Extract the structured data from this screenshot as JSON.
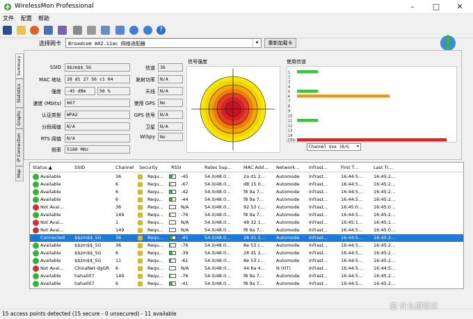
{
  "window": {
    "title": "WirelessMon Professional"
  },
  "menu": [
    "文件",
    "配置",
    "帮助"
  ],
  "adapter": {
    "label": "选择网卡",
    "value": "Broadcom 802.11ac 网络适配器",
    "reload": "重新加载卡"
  },
  "tabs": [
    "Summary",
    "Statistics",
    "Graphs",
    "IP Connection",
    "Map"
  ],
  "summary_left": [
    {
      "label": "SSID",
      "value": "$$zm$$_5G"
    },
    {
      "label": "MAC 地址",
      "value": "28 d1 27 56 c1 04"
    },
    {
      "label": "强度",
      "value": "-45 dBm",
      "value2": "56 %"
    },
    {
      "label": "速度 (Mbits)",
      "value": "667"
    },
    {
      "label": "认证类型",
      "value": "WPA2"
    },
    {
      "label": "分段阈值",
      "value": "N/A"
    },
    {
      "label": "RTS 阈值",
      "value": "N/A"
    },
    {
      "label": "频率",
      "value": "5180 MHz"
    }
  ],
  "summary_right": [
    {
      "label": "信道",
      "value": "36"
    },
    {
      "label": "发射功率",
      "value": "N/A"
    },
    {
      "label": "天线",
      "value": "N/A"
    },
    {
      "label": "使用 GPS",
      "value": "No"
    },
    {
      "label": "GPS 信号",
      "value": "N/A"
    },
    {
      "label": "卫星",
      "value": "N/A"
    },
    {
      "label": "WiSpy",
      "value": "No"
    }
  ],
  "signal_title": "信号强度",
  "channel_title": "使用信道",
  "channel_usage": {
    "labels": [
      "1",
      "2",
      "3",
      "4",
      "5",
      "6",
      "7",
      "8",
      "9",
      "10",
      "11",
      "12",
      "13",
      "14",
      "OTH"
    ],
    "values": [
      7,
      0,
      0,
      0,
      7,
      31,
      0,
      0,
      0,
      0,
      7,
      0,
      0,
      0,
      50
    ],
    "colors": {
      "low": "#2ecc2e",
      "mid": "#e69a1a",
      "high": "#e41e1e"
    },
    "select": "Channel Use (B/G"
  },
  "table": {
    "headers": [
      "Status",
      "SSID",
      "Channel",
      "Security",
      "RSSI",
      "Rates Sup...",
      "MAC Add...",
      "Network...",
      "Infrast...",
      "First T...",
      "Last Ti..."
    ],
    "rows": [
      {
        "color": "#35b335",
        "status": "Available",
        "ssid": "",
        "channel": "36",
        "security": "Requ...",
        "bar": 0.55,
        "rssi": "-45",
        "rates": "54.0/48.0...",
        "mac": "2a d1 2...",
        "network": "Automode",
        "infra": "Infrast...",
        "first": "16:44:5...",
        "last": "16:45:2..."
      },
      {
        "color": "#35b335",
        "status": "Available",
        "ssid": "",
        "channel": "6",
        "security": "Requ...",
        "bar": 0.1,
        "rssi": "-67",
        "rates": "54.0/48.0...",
        "mac": "d8 15 0...",
        "network": "Automode",
        "infra": "Infrast...",
        "first": "16:44:5...",
        "last": "16:45:2..."
      },
      {
        "color": "#35b335",
        "status": "Available",
        "ssid": "",
        "channel": "6",
        "security": "Requ...",
        "bar": 0.55,
        "rssi": "-42",
        "rates": "54.0/48.0...",
        "mac": "f8 9a 7...",
        "network": "Automode",
        "infra": "Infrast...",
        "first": "16:44:5...",
        "last": "16:45:2..."
      },
      {
        "color": "#35b335",
        "status": "Available",
        "ssid": "",
        "channel": "6",
        "security": "Requ...",
        "bar": 0.55,
        "rssi": "-44",
        "rates": "54.0/48.0...",
        "mac": "f8 9a 7...",
        "network": "Automode",
        "infra": "Infrast...",
        "first": "16:44:5...",
        "last": "16:45:2..."
      },
      {
        "color": "#d23030",
        "status": "Not Avai...",
        "ssid": "",
        "channel": "36",
        "security": "Requ...",
        "bar": 0,
        "rssi": "N/A",
        "rates": "54.0/48.0...",
        "mac": "92 53 c...",
        "network": "Automode",
        "infra": "Infrast...",
        "first": "16:45:0...",
        "last": "16:45:0..."
      },
      {
        "color": "#35b335",
        "status": "Available",
        "ssid": "",
        "channel": "149",
        "security": "Requ...",
        "bar": 0.1,
        "rssi": "-76",
        "rates": "54.0/48.0...",
        "mac": "f8 9a 7...",
        "network": "Automode",
        "infra": "Infrast...",
        "first": "16:44:5...",
        "last": "16:45:2..."
      },
      {
        "color": "#d23030",
        "status": "Not Avai...",
        "ssid": "",
        "channel": "1",
        "security": "Requ...",
        "bar": 0,
        "rssi": "N/A",
        "rates": "54.0/48.0...",
        "mac": "48 32 1...",
        "network": "Automode",
        "infra": "Infrast...",
        "first": "16:45:1...",
        "last": "16:45:1..."
      },
      {
        "color": "#d23030",
        "status": "Not Avai...",
        "ssid": "",
        "channel": "149",
        "security": "Requ...",
        "bar": 0,
        "rssi": "N/A",
        "rates": "54.0/48.0...",
        "mac": "f8 9a 7...",
        "network": "Automode",
        "infra": "Infrast...",
        "first": "16:44:5...",
        "last": "16:45:0..."
      },
      {
        "color": "#1f6fd6",
        "status": "Connected",
        "ssid": "$$zm$$_5G",
        "channel": "36",
        "security": "Requ...",
        "bar": 0.55,
        "rssi": "-45",
        "rates": "54.0/48.0...",
        "mac": "28 d1 2...",
        "network": "Automode",
        "infra": "Infrast...",
        "first": "16:44:5...",
        "last": "16:45:2...",
        "selected": true
      },
      {
        "color": "#35b335",
        "status": "Available",
        "ssid": "$$zm$$_5G",
        "channel": "36",
        "security": "Requ...",
        "bar": 0.1,
        "rssi": "-76",
        "rates": "54.0/48.0...",
        "mac": "8e 53 c...",
        "network": "Automode",
        "infra": "Infrast...",
        "first": "16:44:5...",
        "last": "16:45:2..."
      },
      {
        "color": "#35b335",
        "status": "Available",
        "ssid": "$$zm$$_5G",
        "channel": "6",
        "security": "Requ...",
        "bar": 0.45,
        "rssi": "-39",
        "rates": "54.0/48.0...",
        "mac": "28 d1 2...",
        "network": "Automode",
        "infra": "Infrast...",
        "first": "16:44:5...",
        "last": "16:45:2..."
      },
      {
        "color": "#35b335",
        "status": "Available",
        "ssid": "$$zm$$_5G",
        "channel": "11",
        "security": "Requ...",
        "bar": 0.3,
        "rssi": "-61",
        "rates": "54.0/48.0...",
        "mac": "8e 53 c...",
        "network": "Automode",
        "infra": "Infrast...",
        "first": "16:44:5...",
        "last": "16:45:2..."
      },
      {
        "color": "#d23030",
        "status": "Not Avai...",
        "ssid": "ChinaNet-dgGR",
        "channel": "6",
        "security": "Requ...",
        "bar": 0,
        "rssi": "N/A",
        "rates": "54.0/48.0...",
        "mac": "44 ba 4...",
        "network": "N (HT)",
        "infra": "Infrast...",
        "first": "16:44:5...",
        "last": "16:44:5..."
      },
      {
        "color": "#35b335",
        "status": "Available",
        "ssid": "haha007",
        "channel": "149",
        "security": "Requ...",
        "bar": 0.1,
        "rssi": "-76",
        "rates": "54.0/48.0...",
        "mac": "f8 9a 7...",
        "network": "Automode",
        "infra": "Infrast...",
        "first": "16:44:5...",
        "last": "16:45:2..."
      },
      {
        "color": "#35b335",
        "status": "Available",
        "ssid": "haha007",
        "channel": "6",
        "security": "Requ...",
        "bar": 0.55,
        "rssi": "-41",
        "rates": "54.0/48.0...",
        "mac": "f8 9a 7...",
        "network": "Automode",
        "infra": "Infrast...",
        "first": "16:44:5...",
        "last": "16:45:2..."
      }
    ]
  },
  "status": "15 access points detected (15 secure - 0 unsecured) - 11 available",
  "watermark": "值 什么值得买"
}
